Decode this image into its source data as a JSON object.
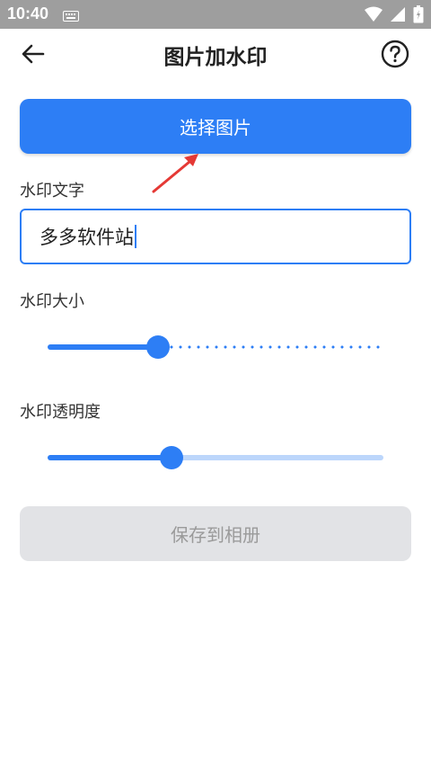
{
  "status_bar": {
    "time": "10:40"
  },
  "header": {
    "title": "图片加水印"
  },
  "select_button": {
    "label": "选择图片"
  },
  "watermark_text": {
    "label": "水印文字",
    "value": "多多软件站"
  },
  "watermark_size": {
    "label": "水印大小",
    "value_fraction": 0.33
  },
  "watermark_opacity": {
    "label": "水印透明度",
    "value_fraction": 0.37
  },
  "save_button": {
    "label": "保存到相册"
  },
  "colors": {
    "accent": "#2d7ef5",
    "disabled_bg": "#e2e3e6",
    "disabled_text": "#9a9a9a",
    "annotation_arrow": "#e53935"
  },
  "icons": [
    "back-arrow-icon",
    "help-circle-icon",
    "keyboard-icon",
    "wifi-icon",
    "signal-icon",
    "battery-icon"
  ]
}
